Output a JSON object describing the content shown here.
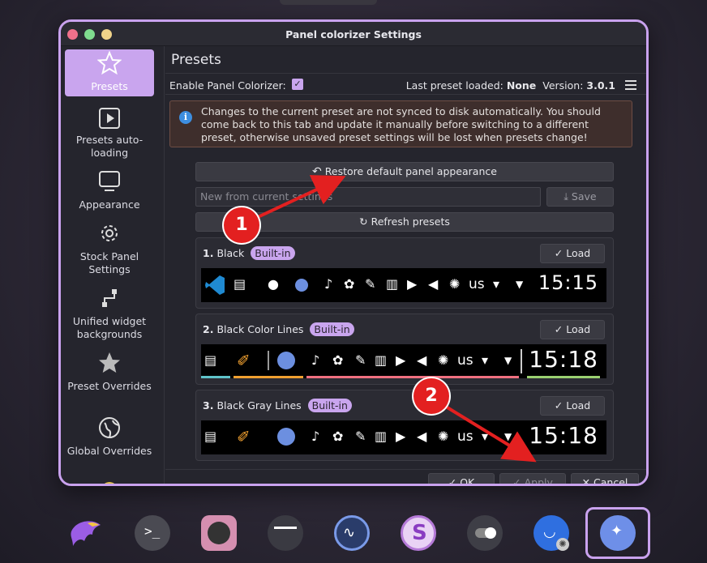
{
  "window": {
    "title": "Panel colorizer Settings"
  },
  "sidebar": {
    "items": [
      {
        "label": "Presets",
        "icon": "star-icon"
      },
      {
        "label": "Presets auto-loading",
        "icon": "play-icon"
      },
      {
        "label": "Appearance",
        "icon": "monitor-icon"
      },
      {
        "label": "Stock Panel Settings",
        "icon": "gear-icon"
      },
      {
        "label": "Unified widget backgrounds",
        "icon": "link-icon"
      },
      {
        "label": "Preset Overrides",
        "icon": "star-half-icon"
      },
      {
        "label": "Global Overrides",
        "icon": "globe-icon"
      }
    ]
  },
  "main": {
    "heading": "Presets",
    "enable_label": "Enable Panel Colorizer:",
    "enable_checked": "✓",
    "last_preset_label": "Last preset loaded:",
    "last_preset_value": "None",
    "version_label": "Version:",
    "version_value": "3.0.1",
    "info_text": "Changes to the current preset are not synced to disk automatically. You should come back to this tab and update it manually before switching to a different preset, otherwise unsaved preset settings will be lost when presets change!",
    "restore_label": "Restore default panel appearance",
    "new_preset_placeholder": "New from current settings",
    "save_label": "Save",
    "refresh_label": "Refresh presets",
    "load_label": "Load",
    "builtin_label": "Built-in",
    "presets": [
      {
        "index": "1.",
        "name": "Black",
        "clock": "15:15"
      },
      {
        "index": "2.",
        "name": "Black Color Lines",
        "clock": "15:18"
      },
      {
        "index": "3.",
        "name": "Black Gray Lines",
        "clock": "15:18"
      }
    ],
    "tray_text": "us"
  },
  "actions": {
    "ok": "OK",
    "apply": "Apply",
    "cancel": "Cancel"
  },
  "markers": {
    "one": "1",
    "two": "2"
  },
  "colors": {
    "accent": "#c9a2ee",
    "marker": "#e32020"
  }
}
